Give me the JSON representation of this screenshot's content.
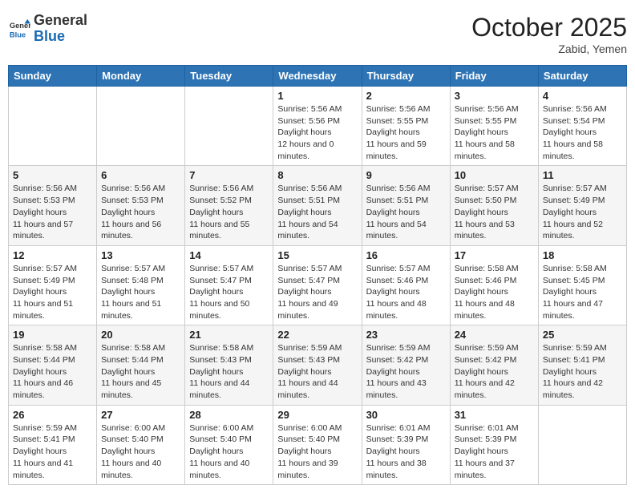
{
  "header": {
    "logo_line1": "General",
    "logo_line2": "Blue",
    "month": "October 2025",
    "location": "Zabid, Yemen"
  },
  "weekdays": [
    "Sunday",
    "Monday",
    "Tuesday",
    "Wednesday",
    "Thursday",
    "Friday",
    "Saturday"
  ],
  "weeks": [
    [
      {
        "day": null
      },
      {
        "day": null
      },
      {
        "day": null
      },
      {
        "day": "1",
        "sunrise": "5:56 AM",
        "sunset": "5:56 PM",
        "daylight": "12 hours and 0 minutes."
      },
      {
        "day": "2",
        "sunrise": "5:56 AM",
        "sunset": "5:55 PM",
        "daylight": "11 hours and 59 minutes."
      },
      {
        "day": "3",
        "sunrise": "5:56 AM",
        "sunset": "5:55 PM",
        "daylight": "11 hours and 58 minutes."
      },
      {
        "day": "4",
        "sunrise": "5:56 AM",
        "sunset": "5:54 PM",
        "daylight": "11 hours and 58 minutes."
      }
    ],
    [
      {
        "day": "5",
        "sunrise": "5:56 AM",
        "sunset": "5:53 PM",
        "daylight": "11 hours and 57 minutes."
      },
      {
        "day": "6",
        "sunrise": "5:56 AM",
        "sunset": "5:53 PM",
        "daylight": "11 hours and 56 minutes."
      },
      {
        "day": "7",
        "sunrise": "5:56 AM",
        "sunset": "5:52 PM",
        "daylight": "11 hours and 55 minutes."
      },
      {
        "day": "8",
        "sunrise": "5:56 AM",
        "sunset": "5:51 PM",
        "daylight": "11 hours and 54 minutes."
      },
      {
        "day": "9",
        "sunrise": "5:56 AM",
        "sunset": "5:51 PM",
        "daylight": "11 hours and 54 minutes."
      },
      {
        "day": "10",
        "sunrise": "5:57 AM",
        "sunset": "5:50 PM",
        "daylight": "11 hours and 53 minutes."
      },
      {
        "day": "11",
        "sunrise": "5:57 AM",
        "sunset": "5:49 PM",
        "daylight": "11 hours and 52 minutes."
      }
    ],
    [
      {
        "day": "12",
        "sunrise": "5:57 AM",
        "sunset": "5:49 PM",
        "daylight": "11 hours and 51 minutes."
      },
      {
        "day": "13",
        "sunrise": "5:57 AM",
        "sunset": "5:48 PM",
        "daylight": "11 hours and 51 minutes."
      },
      {
        "day": "14",
        "sunrise": "5:57 AM",
        "sunset": "5:47 PM",
        "daylight": "11 hours and 50 minutes."
      },
      {
        "day": "15",
        "sunrise": "5:57 AM",
        "sunset": "5:47 PM",
        "daylight": "11 hours and 49 minutes."
      },
      {
        "day": "16",
        "sunrise": "5:57 AM",
        "sunset": "5:46 PM",
        "daylight": "11 hours and 48 minutes."
      },
      {
        "day": "17",
        "sunrise": "5:58 AM",
        "sunset": "5:46 PM",
        "daylight": "11 hours and 48 minutes."
      },
      {
        "day": "18",
        "sunrise": "5:58 AM",
        "sunset": "5:45 PM",
        "daylight": "11 hours and 47 minutes."
      }
    ],
    [
      {
        "day": "19",
        "sunrise": "5:58 AM",
        "sunset": "5:44 PM",
        "daylight": "11 hours and 46 minutes."
      },
      {
        "day": "20",
        "sunrise": "5:58 AM",
        "sunset": "5:44 PM",
        "daylight": "11 hours and 45 minutes."
      },
      {
        "day": "21",
        "sunrise": "5:58 AM",
        "sunset": "5:43 PM",
        "daylight": "11 hours and 44 minutes."
      },
      {
        "day": "22",
        "sunrise": "5:59 AM",
        "sunset": "5:43 PM",
        "daylight": "11 hours and 44 minutes."
      },
      {
        "day": "23",
        "sunrise": "5:59 AM",
        "sunset": "5:42 PM",
        "daylight": "11 hours and 43 minutes."
      },
      {
        "day": "24",
        "sunrise": "5:59 AM",
        "sunset": "5:42 PM",
        "daylight": "11 hours and 42 minutes."
      },
      {
        "day": "25",
        "sunrise": "5:59 AM",
        "sunset": "5:41 PM",
        "daylight": "11 hours and 42 minutes."
      }
    ],
    [
      {
        "day": "26",
        "sunrise": "5:59 AM",
        "sunset": "5:41 PM",
        "daylight": "11 hours and 41 minutes."
      },
      {
        "day": "27",
        "sunrise": "6:00 AM",
        "sunset": "5:40 PM",
        "daylight": "11 hours and 40 minutes."
      },
      {
        "day": "28",
        "sunrise": "6:00 AM",
        "sunset": "5:40 PM",
        "daylight": "11 hours and 40 minutes."
      },
      {
        "day": "29",
        "sunrise": "6:00 AM",
        "sunset": "5:40 PM",
        "daylight": "11 hours and 39 minutes."
      },
      {
        "day": "30",
        "sunrise": "6:01 AM",
        "sunset": "5:39 PM",
        "daylight": "11 hours and 38 minutes."
      },
      {
        "day": "31",
        "sunrise": "6:01 AM",
        "sunset": "5:39 PM",
        "daylight": "11 hours and 37 minutes."
      },
      {
        "day": null
      }
    ]
  ],
  "labels": {
    "sunrise_prefix": "Sunrise: ",
    "sunset_prefix": "Sunset: ",
    "daylight_prefix": "Daylight hours"
  }
}
